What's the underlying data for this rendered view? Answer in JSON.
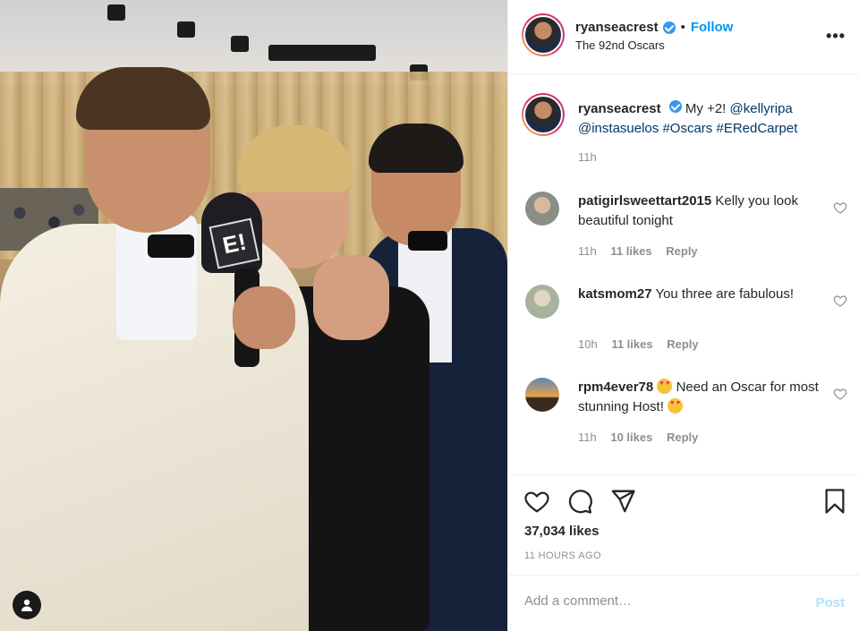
{
  "post": {
    "username": "ryanseacrest",
    "separator": "•",
    "follow_label": "Follow",
    "location": "The 92nd Oscars",
    "more_label": "•••",
    "photo_mic_label": "E!"
  },
  "caption": {
    "username": "ryanseacrest",
    "text_plain": "My +2! ",
    "mention1": "@kellyripa",
    "mention2": "@instasuelos",
    "hashtag1": "#Oscars",
    "hashtag2": "#ERedCarpet",
    "time": "11h"
  },
  "comments": [
    {
      "username": "patigirlsweettart2015",
      "text": "Kelly you look beautiful tonight",
      "time": "11h",
      "likes": "11 likes",
      "reply": "Reply"
    },
    {
      "username": "katsmom27",
      "text": "You three are fabulous!",
      "time": "10h",
      "likes": "11 likes",
      "reply": "Reply"
    },
    {
      "username": "rpm4ever78",
      "text": "Need an Oscar for most stunning Host!",
      "time": "11h",
      "likes": "10 likes",
      "reply": "Reply"
    }
  ],
  "actions": {
    "likes": "37,034 likes",
    "time_ago": "11 HOURS AGO",
    "icons": [
      "heart-icon",
      "comment-icon",
      "share-icon",
      "bookmark-icon"
    ]
  },
  "add_comment": {
    "placeholder": "Add a comment…",
    "post_label": "Post"
  },
  "colors": {
    "link": "#00376b",
    "follow": "#0095f6",
    "verified": "#3897f0",
    "post_disabled": "#b2dffc",
    "meta": "#8e8e8e"
  }
}
